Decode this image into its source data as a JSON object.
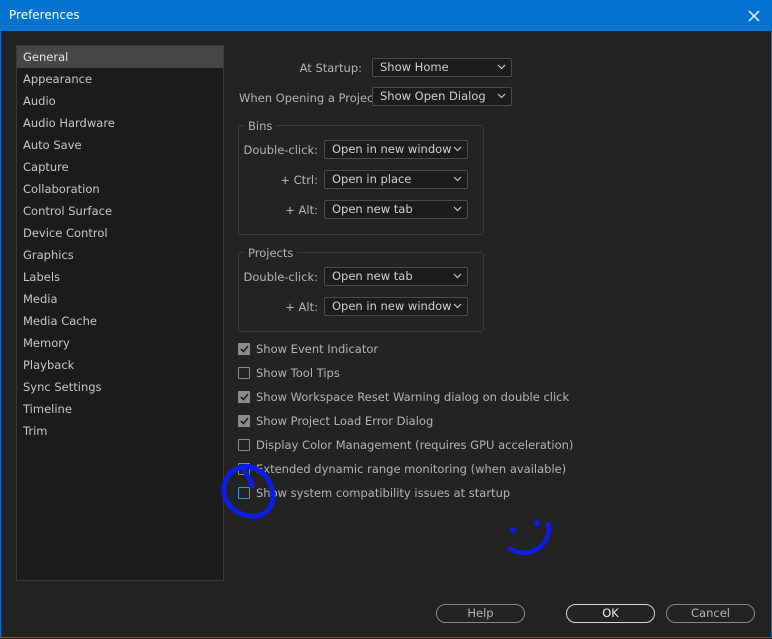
{
  "window": {
    "title": "Preferences"
  },
  "sidebar": {
    "items": [
      "General",
      "Appearance",
      "Audio",
      "Audio Hardware",
      "Auto Save",
      "Capture",
      "Collaboration",
      "Control Surface",
      "Device Control",
      "Graphics",
      "Labels",
      "Media",
      "Media Cache",
      "Memory",
      "Playback",
      "Sync Settings",
      "Timeline",
      "Trim"
    ],
    "selected": "General"
  },
  "general": {
    "at_startup": {
      "label": "At Startup:",
      "value": "Show Home"
    },
    "when_opening": {
      "label": "When Opening a Project:",
      "value": "Show Open Dialog"
    },
    "bins": {
      "title": "Bins",
      "double_click": {
        "label": "Double-click:",
        "value": "Open in new window"
      },
      "ctrl": {
        "label": "+ Ctrl:",
        "value": "Open in place"
      },
      "alt": {
        "label": "+ Alt:",
        "value": "Open new tab"
      }
    },
    "projects": {
      "title": "Projects",
      "double_click": {
        "label": "Double-click:",
        "value": "Open new tab"
      },
      "alt": {
        "label": "+ Alt:",
        "value": "Open in new window"
      }
    },
    "checkboxes": [
      {
        "label": "Show Event Indicator",
        "checked": true
      },
      {
        "label": "Show Tool Tips",
        "checked": false
      },
      {
        "label": "Show Workspace Reset Warning dialog on double click",
        "checked": true
      },
      {
        "label": "Show Project Load Error Dialog",
        "checked": true
      },
      {
        "label": "Display Color Management (requires GPU acceleration)",
        "checked": false
      },
      {
        "label": "Extended dynamic range monitoring (when available)",
        "checked": false
      },
      {
        "label": "Show system compatibility issues at startup",
        "checked": false
      }
    ]
  },
  "buttons": {
    "help": "Help",
    "ok": "OK",
    "cancel": "Cancel"
  },
  "colors": {
    "titlebar": "#0473d0",
    "ink": "#0a1ee6"
  }
}
